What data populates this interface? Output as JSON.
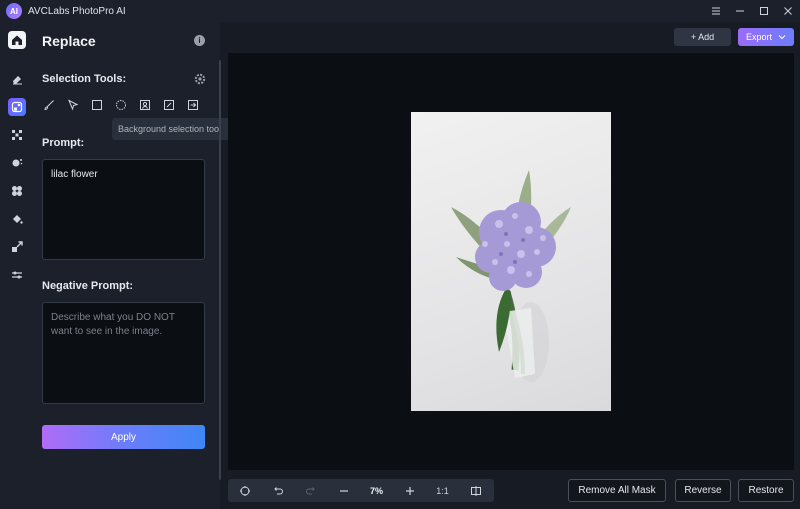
{
  "app": {
    "title": "AVCLabs PhotoPro AI",
    "logo_text": "AI"
  },
  "window_controls": [
    "menu-icon",
    "minimize-icon",
    "maximize-icon",
    "close-icon"
  ],
  "rail": {
    "items": [
      {
        "name": "home-icon",
        "active": false
      },
      {
        "name": "eraser-icon",
        "active": false
      },
      {
        "name": "replace-icon",
        "active": true
      },
      {
        "name": "enhance-icon",
        "active": false
      },
      {
        "name": "background-icon",
        "active": false
      },
      {
        "name": "ai-tools-icon",
        "active": false
      },
      {
        "name": "colorize-icon",
        "active": false
      },
      {
        "name": "upscale-icon",
        "active": false
      },
      {
        "name": "adjust-icon",
        "active": false
      }
    ]
  },
  "panel": {
    "title": "Replace",
    "selection_tools_label": "Selection Tools:",
    "tools": [
      "brush-icon",
      "lasso-pointer-icon",
      "rectangle-select-icon",
      "background-select-icon",
      "portrait-select-icon",
      "object-select-icon",
      "import-mask-icon"
    ],
    "tooltip": "Background selection tool",
    "prompt_label": "Prompt:",
    "prompt_value": "lilac flower",
    "negative_label": "Negative Prompt:",
    "negative_placeholder": "Describe what you DO NOT want to see in the image.",
    "apply_label": "Apply"
  },
  "toolbar": {
    "add_label": "+ Add",
    "export_label": "Export"
  },
  "bottom": {
    "zoom": "7%",
    "one_to_one": "1:1",
    "remove_all_mask": "Remove All Mask",
    "reverse": "Reverse",
    "restore": "Restore"
  },
  "colors": {
    "accent_start": "#b06cf7",
    "accent_end": "#3f86f5",
    "background": "#161b24",
    "canvas": "#0b0e13"
  }
}
